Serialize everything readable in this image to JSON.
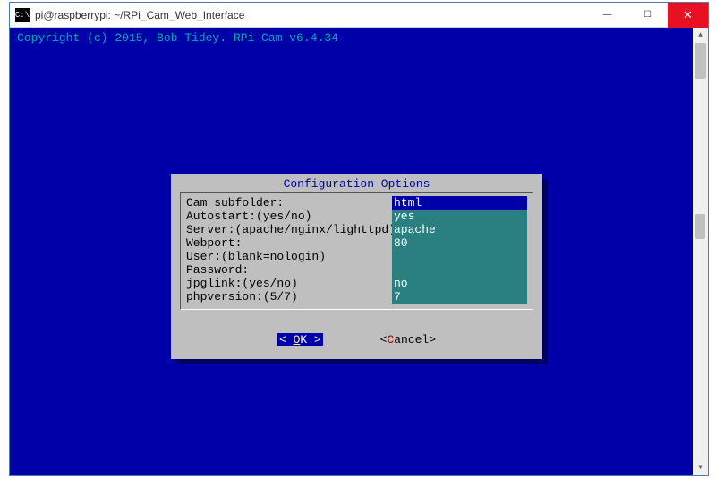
{
  "window": {
    "icon_text": "C:\\",
    "title": "pi@raspberrypi: ~/RPi_Cam_Web_Interface",
    "minimize": "—",
    "maximize": "☐",
    "close": "✕"
  },
  "copyright": "Copyright (c) 2015, Bob Tidey. RPi Cam v6.4.34",
  "dialog": {
    "title": "Configuration Options",
    "fields": [
      {
        "label": "Cam subfolder:",
        "value": "html",
        "selected": true
      },
      {
        "label": "Autostart:(yes/no)",
        "value": "yes",
        "selected": false
      },
      {
        "label": "Server:(apache/nginx/lighttpd)",
        "value": "apache",
        "selected": false
      },
      {
        "label": "Webport:",
        "value": "80",
        "selected": false
      },
      {
        "label": "User:(blank=nologin)",
        "value": "",
        "selected": false
      },
      {
        "label": "Password:",
        "value": "",
        "selected": false
      },
      {
        "label": "jpglink:(yes/no)",
        "value": "no",
        "selected": false
      },
      {
        "label": "phpversion:(5/7)",
        "value": "7",
        "selected": false
      }
    ],
    "ok_pre": "<  ",
    "ok_hot": "O",
    "ok_post": "K  >",
    "cancel_pre": "<",
    "cancel_hot": "C",
    "cancel_post": "ancel>"
  }
}
